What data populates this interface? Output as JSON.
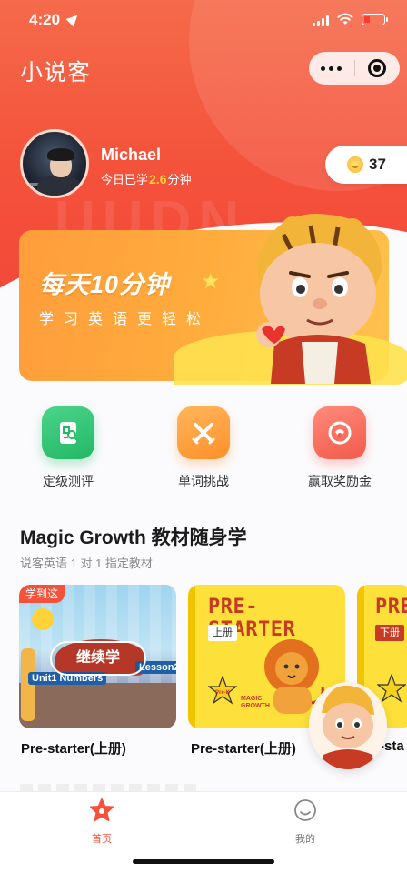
{
  "status_bar": {
    "time": "4:20"
  },
  "header": {
    "app_title": "小说客",
    "more_icon": "more-dots-icon",
    "close_icon": "target-circle-icon"
  },
  "profile": {
    "name": "Michael",
    "study_prefix": "今日已学",
    "study_minutes": "2.6",
    "study_suffix": "分钟"
  },
  "coins": {
    "icon": "coin-smile-icon",
    "value": "37"
  },
  "banner": {
    "headline": "每天10分钟",
    "subtitle": "学习英语更轻松"
  },
  "functions": [
    {
      "label": "定级测评",
      "icon": "assessment-doc-icon"
    },
    {
      "label": "单词挑战",
      "icon": "crossed-swords-icon"
    },
    {
      "label": "赢取奖励金",
      "icon": "reward-coin-icon"
    }
  ],
  "section": {
    "title": "Magic Growth 教材随身学",
    "subtitle": "说客英语 1 对 1 指定教材"
  },
  "textbooks": [
    {
      "tag": "学到这",
      "action": "继续学",
      "unit_text": "Unit1 Numbers",
      "lesson_text": "Lesson2",
      "name": "Pre-starter(上册)"
    },
    {
      "cover_title": "PRE-STARTER",
      "volume": "上册",
      "badge": "Pre-K",
      "brand": "MAGIC GROWTH",
      "name": "Pre-starter(上册)"
    },
    {
      "cover_title": "PRE",
      "volume": "下册",
      "badge": "Pre-K",
      "name": "-sta"
    }
  ],
  "tabbar": {
    "home": "首页",
    "mine": "我的"
  },
  "colors": {
    "primary": "#f4523b",
    "banner": "#ffa93d",
    "accent_yellow": "#ffd23a"
  }
}
